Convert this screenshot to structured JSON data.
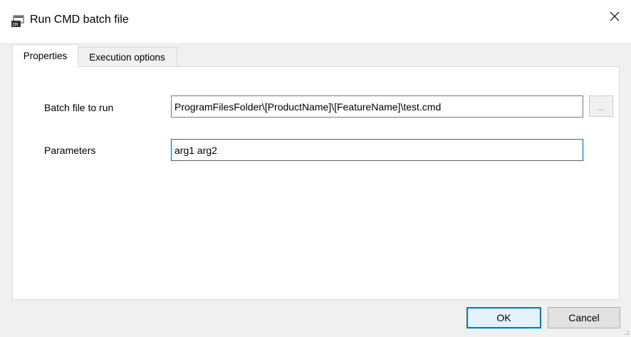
{
  "window": {
    "title": "Run CMD batch file",
    "icon": "batch-file-icon",
    "close_glyph": "✕"
  },
  "tabs": [
    {
      "label": "Properties",
      "selected": true
    },
    {
      "label": "Execution options",
      "selected": false
    }
  ],
  "properties": {
    "batch_file": {
      "label": "Batch file to run",
      "value": "ProgramFilesFolder\\[ProductName]\\[FeatureName]\\test.cmd"
    },
    "browse_label": "...",
    "parameters": {
      "label": "Parameters",
      "value": "arg1 arg2"
    }
  },
  "buttons": {
    "ok": "OK",
    "cancel": "Cancel"
  },
  "colors": {
    "accent": "#0078d7",
    "window_bg": "#f0f0f0",
    "panel_bg": "#ffffff"
  }
}
